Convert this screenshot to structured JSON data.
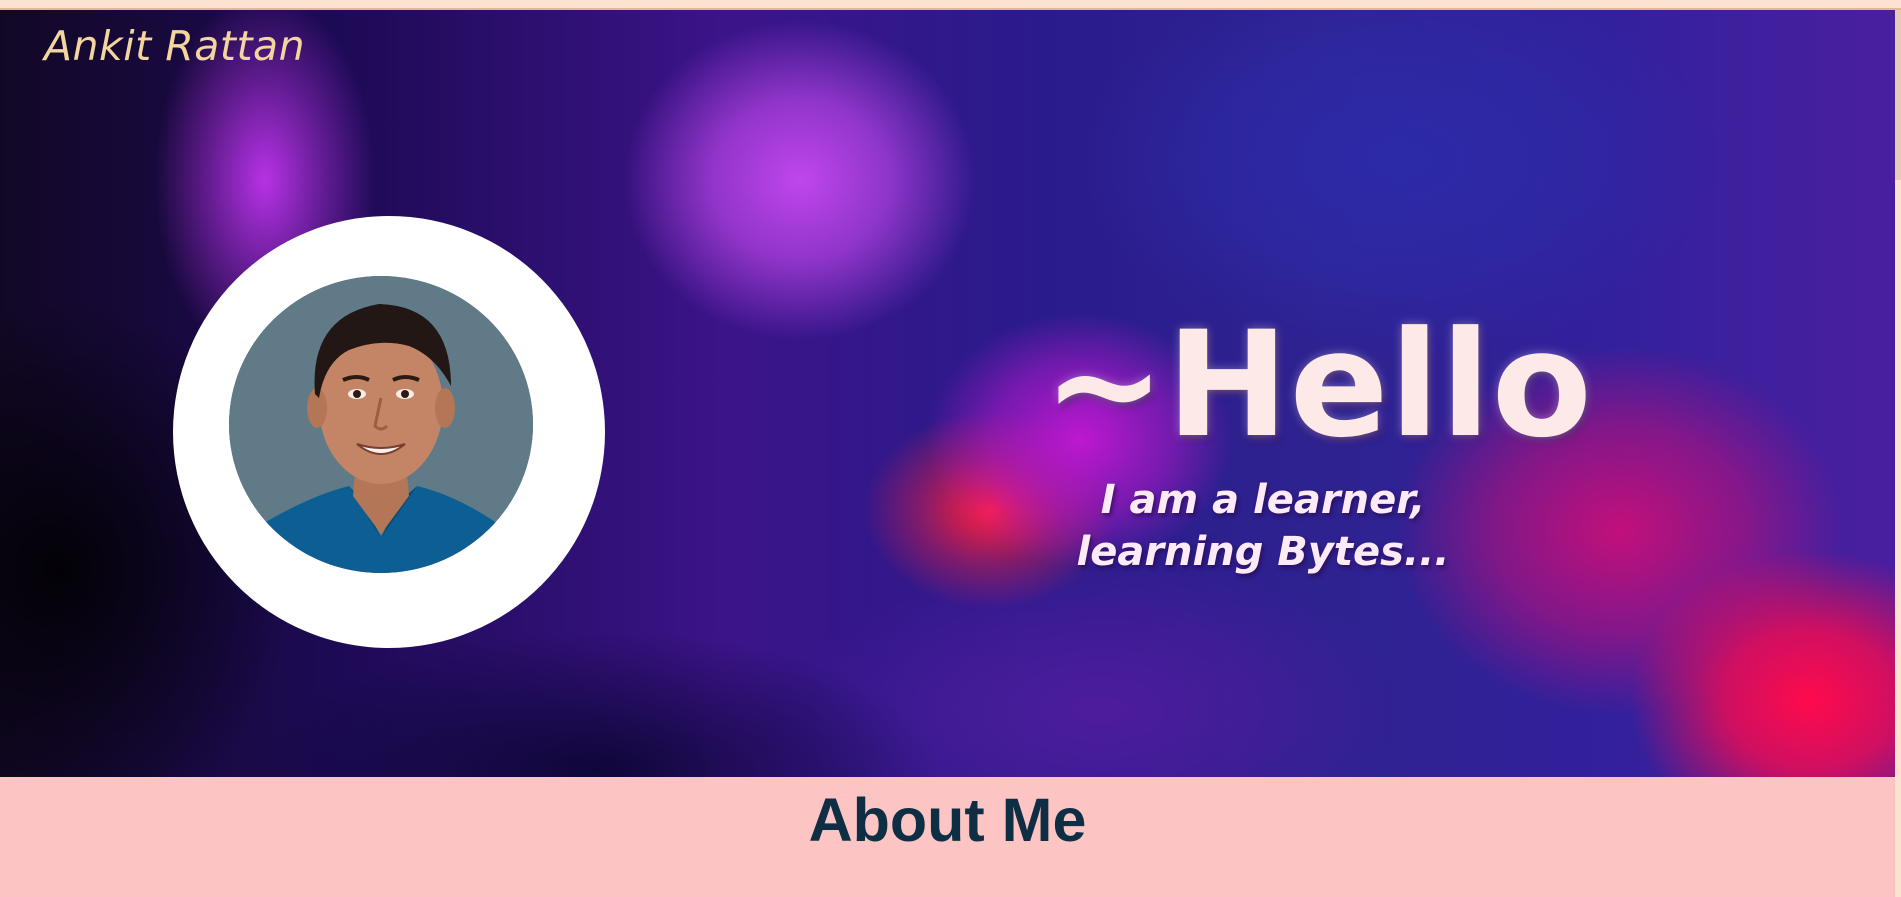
{
  "header": {
    "brand": "Ankit Rattan"
  },
  "hero": {
    "greeting": "~Hello",
    "tagline_line1": "I am a learner,",
    "tagline_line2": "learning Bytes..."
  },
  "about": {
    "title": "About Me"
  },
  "colors": {
    "brand_text": "#f3d59e",
    "about_bg": "#fcc5c4",
    "about_title": "#0e2e44",
    "greeting_text": "#fde9e7"
  },
  "icons": {
    "profile_photo": "avatar-photo"
  }
}
